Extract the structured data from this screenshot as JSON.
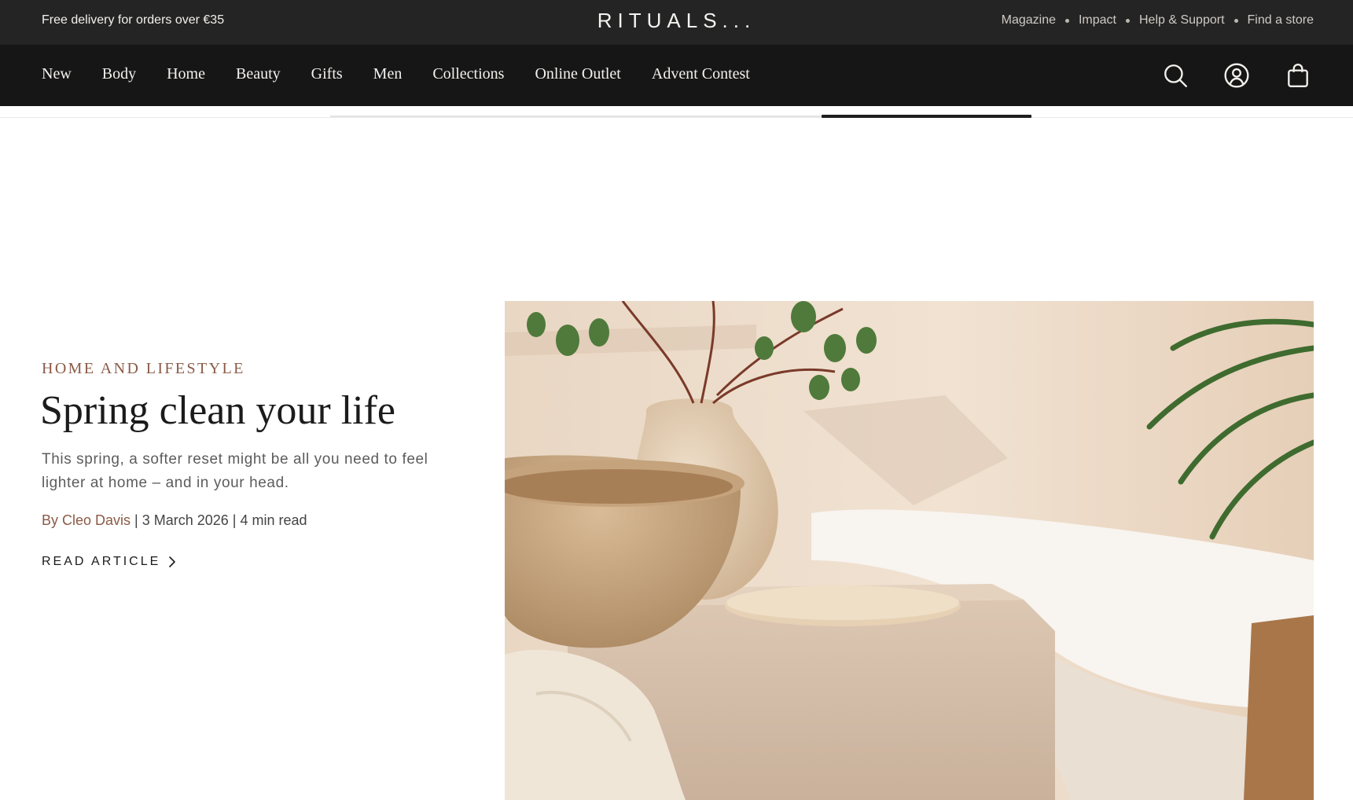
{
  "topbar": {
    "promo": "Free delivery for orders over €35",
    "logo": "RITUALS...",
    "links": [
      "Magazine",
      "Impact",
      "Help & Support",
      "Find a store"
    ]
  },
  "nav": {
    "items": [
      "New",
      "Body",
      "Home",
      "Beauty",
      "Gifts",
      "Men",
      "Collections",
      "Online Outlet",
      "Advent Contest"
    ],
    "icons": [
      "search-icon",
      "account-icon",
      "bag-icon"
    ]
  },
  "article": {
    "category": "HOME AND LIFESTYLE",
    "title": "Spring clean your life",
    "description": "This spring, a softer reset might be all you need to feel lighter at home – and in your head.",
    "author": "By Cleo Davis",
    "meta_rest": " | 3 March 2026 | 4 min read",
    "cta": "READ ARTICLE",
    "image_alt": "Marble bowl, ceramic vase with eucalyptus and a towel beside a bathtub"
  },
  "colors": {
    "topbar_bg": "#242424",
    "nav_bg": "#161616",
    "accent": "#8a5a46",
    "text": "#1b1b1b"
  }
}
